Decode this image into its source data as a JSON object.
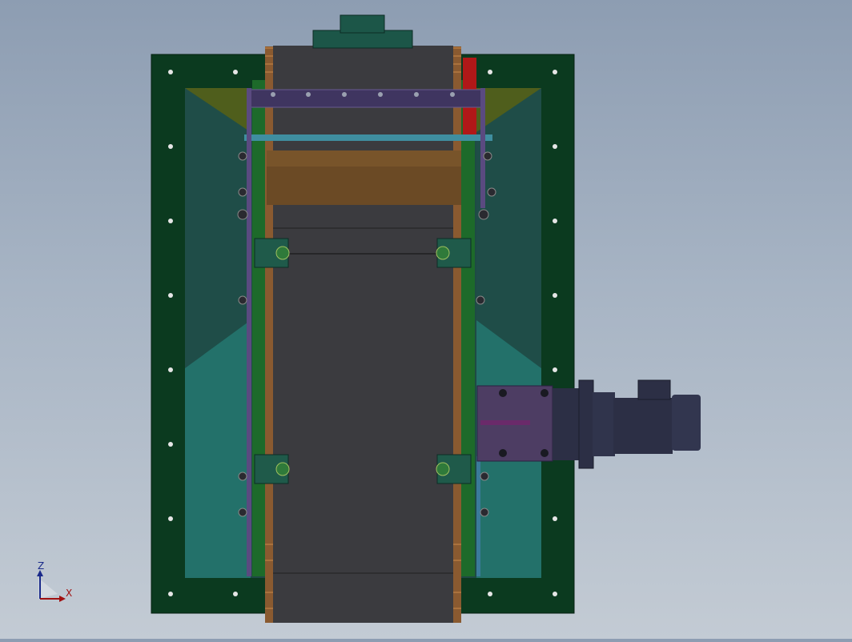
{
  "viewport": {
    "background_top": "#8d9db2",
    "background_bottom": "#c3cbd4"
  },
  "model": {
    "frame_color": "#0b3a1f",
    "hopper_dark": "#1f4f4a",
    "hopper_light": "#236b64",
    "belt_color": "#3b3b3f",
    "roller_color": "#6b4a25",
    "motor_color": "#2c2f45",
    "gearbox_color": "#4d3d63",
    "rail_color": "#1d6a2a"
  },
  "triad": {
    "z_label": "Z",
    "x_label": "X",
    "z_icon": "axis-arrow-up-icon",
    "x_icon": "axis-arrow-right-icon"
  }
}
